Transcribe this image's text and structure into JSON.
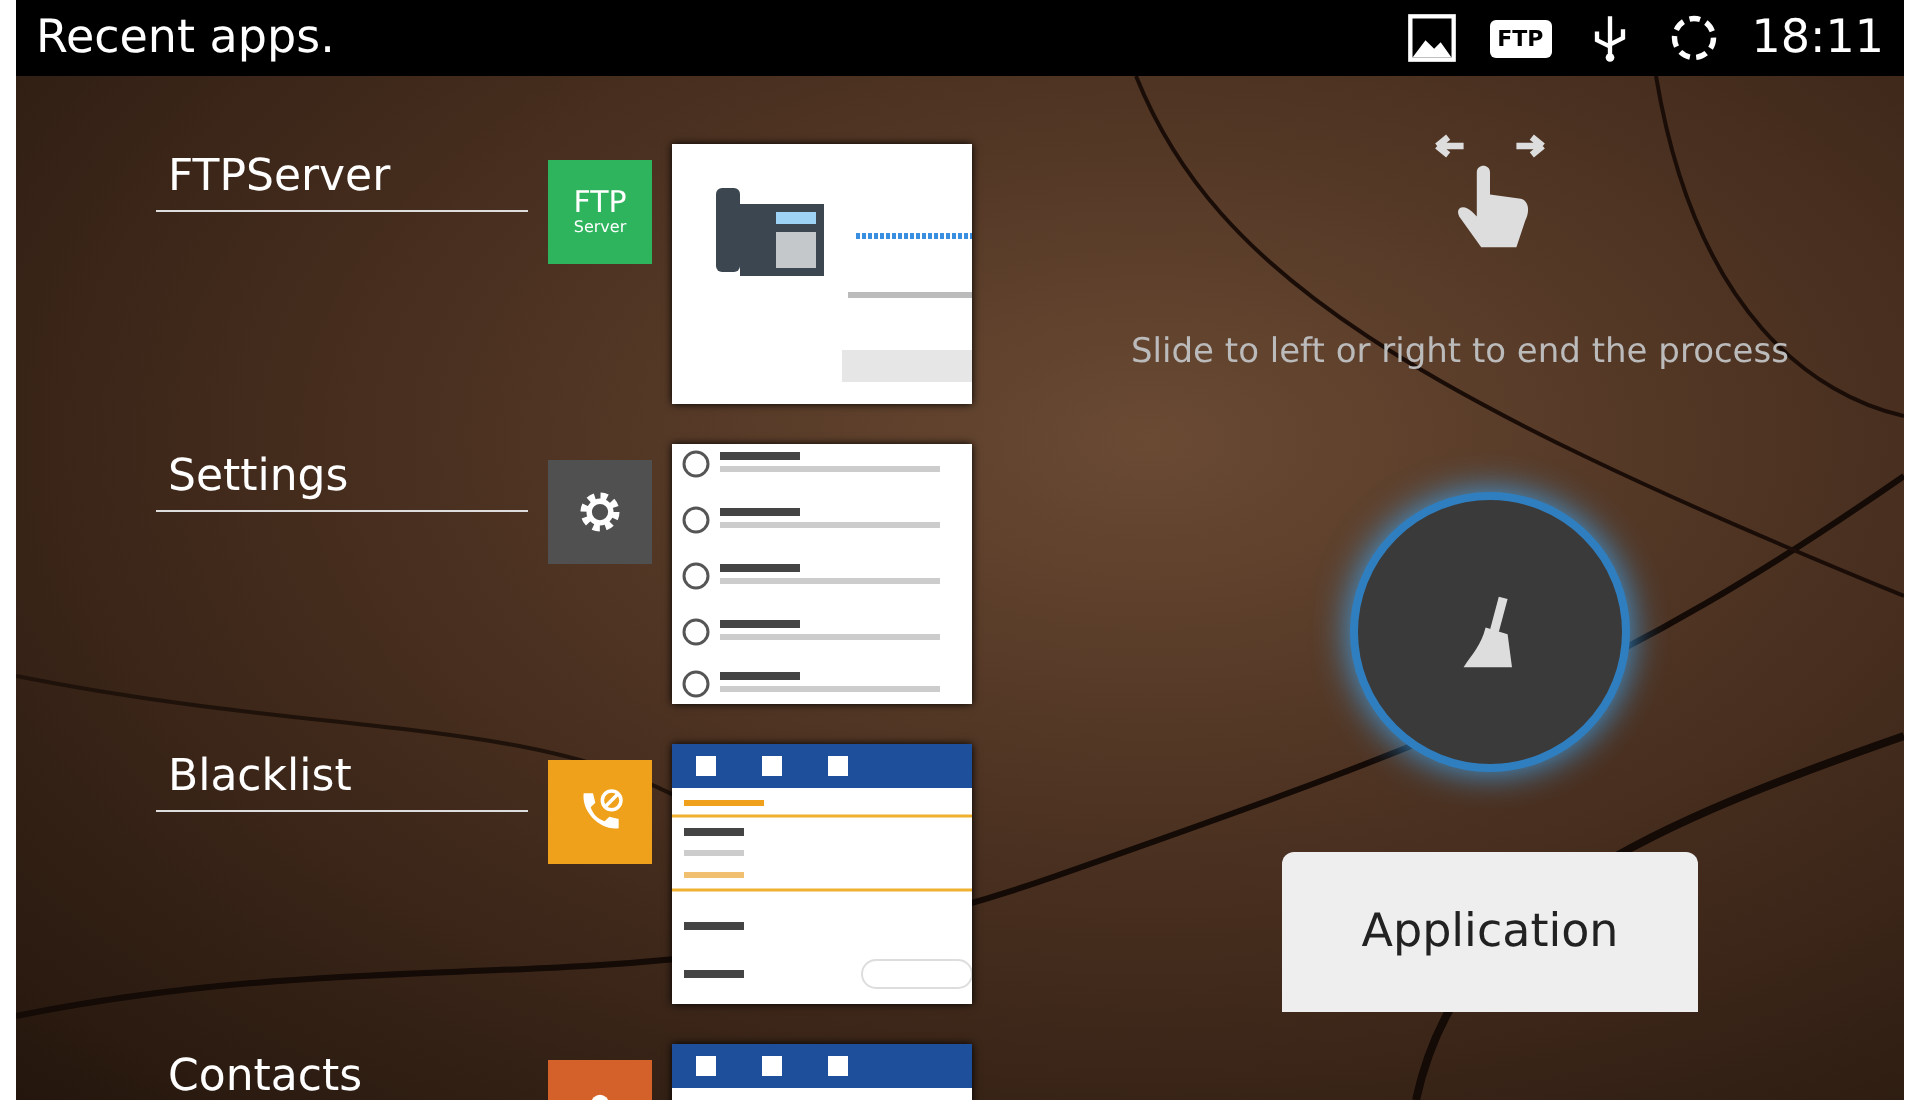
{
  "status_bar": {
    "title": "Recent apps.",
    "ftp_badge": "FTP",
    "time": "18:11"
  },
  "apps": [
    {
      "name": "FTPServer",
      "kind": "ftp",
      "icon_text": "FTP",
      "icon_subtext": "Server",
      "color": "#2db45c"
    },
    {
      "name": "Settings",
      "kind": "settings",
      "color": "#505050"
    },
    {
      "name": "Blacklist",
      "kind": "blacklist",
      "color": "#f0a11c"
    },
    {
      "name": "Contacts",
      "kind": "contacts",
      "color": "#d4612a"
    }
  ],
  "hint": "Slide to left or right to end the process",
  "application_button": "Application"
}
